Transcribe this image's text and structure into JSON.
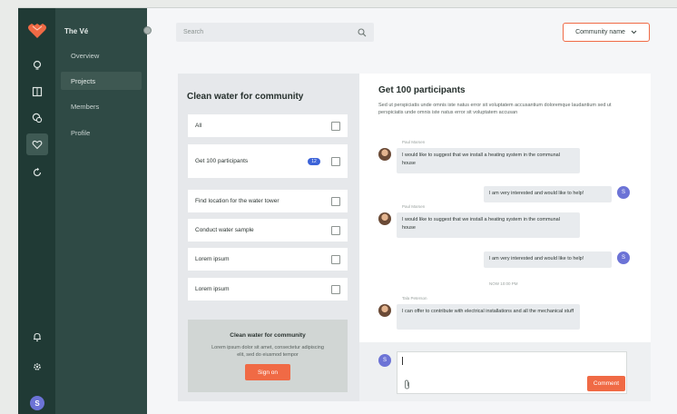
{
  "sidebar": {
    "team_name": "The Vé",
    "items": [
      {
        "label": "Overview",
        "active": false
      },
      {
        "label": "Projects",
        "active": true
      },
      {
        "label": "Members",
        "active": false
      },
      {
        "label": "Profile",
        "active": false
      }
    ],
    "rail_icons": [
      "logo-heart-icon",
      "lightbulb-icon",
      "book-icon",
      "chat-icon",
      "heart-icon",
      "refresh-icon",
      "bell-icon",
      "gear-icon"
    ],
    "user_initial": "S"
  },
  "header": {
    "search_placeholder": "Search",
    "community_button": "Community name"
  },
  "tasks": {
    "title": "Clean water for community",
    "items": [
      {
        "label": "All",
        "badge": ""
      },
      {
        "label": "Get 100 participants",
        "badge": "12"
      },
      {
        "label": "Find location for the water tower",
        "badge": ""
      },
      {
        "label": "Conduct water sample",
        "badge": ""
      },
      {
        "label": "Lorem ipsum",
        "badge": ""
      },
      {
        "label": "Lorem ipsum",
        "badge": ""
      }
    ],
    "promo": {
      "title": "Clean water for community",
      "desc": "Lorem ipsum dolor sit amet, consectetur adipiscing elit, sed do eiusmod tempor",
      "button": "Sign on"
    }
  },
  "chat": {
    "title": "Get 100 participants",
    "desc": "Sed ut perspiciatis unde omnis iste natus error sit voluptatem accusantium doloremque laudantium sed ut perspiciatis unde omnis iste natus error sit voluptatem accusan",
    "messages": [
      {
        "from": "other",
        "name": "Paul Marsen",
        "text": "I would like to suggest that we install a heating system in the communal house"
      },
      {
        "from": "self",
        "initial": "S",
        "text": "I am very interested and would like to help!"
      },
      {
        "from": "other",
        "name": "Paul Marsen",
        "text": "I would like to suggest that we install a heating system in the communal house"
      },
      {
        "from": "self",
        "initial": "S",
        "text": "I am very interested and would like to help!",
        "time": "NOW 10:00 PM"
      },
      {
        "from": "other",
        "name": "Tala Peterson",
        "text": "I can offer to contribute with electrical installations and all the mechanical stuff"
      }
    ],
    "composer_initial": "S",
    "send_button": "Comment"
  },
  "colors": {
    "accent": "#f06a45",
    "rail": "#203a35",
    "nav": "#2f4a45",
    "badge": "#3c63d8",
    "avatar": "#6c73d6"
  }
}
